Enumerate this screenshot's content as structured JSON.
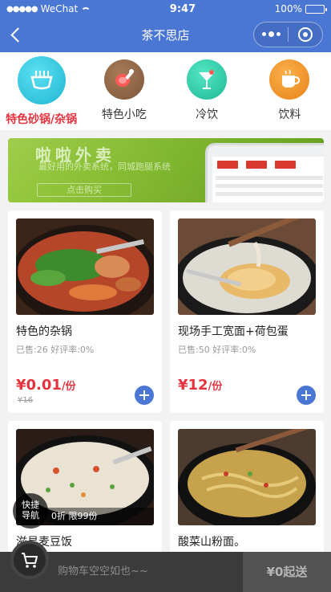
{
  "status_bar": {
    "carrier": "WeChat",
    "time": "9:47",
    "battery": "100%"
  },
  "nav": {
    "title": "茶不思店"
  },
  "categories": [
    {
      "label": "特色砂锅/杂锅",
      "icon": "bowl-icon",
      "active": true
    },
    {
      "label": "特色小吃",
      "icon": "drumstick-icon",
      "active": false
    },
    {
      "label": "冷饮",
      "icon": "cocktail-icon",
      "active": false
    },
    {
      "label": "饮料",
      "icon": "coffee-cup-icon",
      "active": false
    }
  ],
  "banner": {
    "title": "啦啦外卖",
    "subtitle": "最好用的外卖系统，同城跑腿系统",
    "button": "点击购买"
  },
  "products": [
    {
      "name": "特色的杂锅",
      "meta": "已售:26 好评率:0%",
      "price": "¥0.01",
      "unit": "/份",
      "original": "¥16"
    },
    {
      "name": "现场手工宽面+荷包蛋",
      "meta": "已售:50 好评率:0%",
      "price": "¥12",
      "unit": "/份",
      "original": ""
    },
    {
      "name": "滋易麦豆饭",
      "promo": "0折 限99份"
    },
    {
      "name": "酸菜山粉面。"
    }
  ],
  "quick_nav": {
    "line1": "快捷",
    "line2": "导航"
  },
  "cart": {
    "empty_text": "购物车空空如也~~",
    "min_order": "¥0起送"
  },
  "colors": {
    "primary": "#4b77d4",
    "price_red": "#e6333f",
    "cart_bar": "#3b3b3b"
  }
}
